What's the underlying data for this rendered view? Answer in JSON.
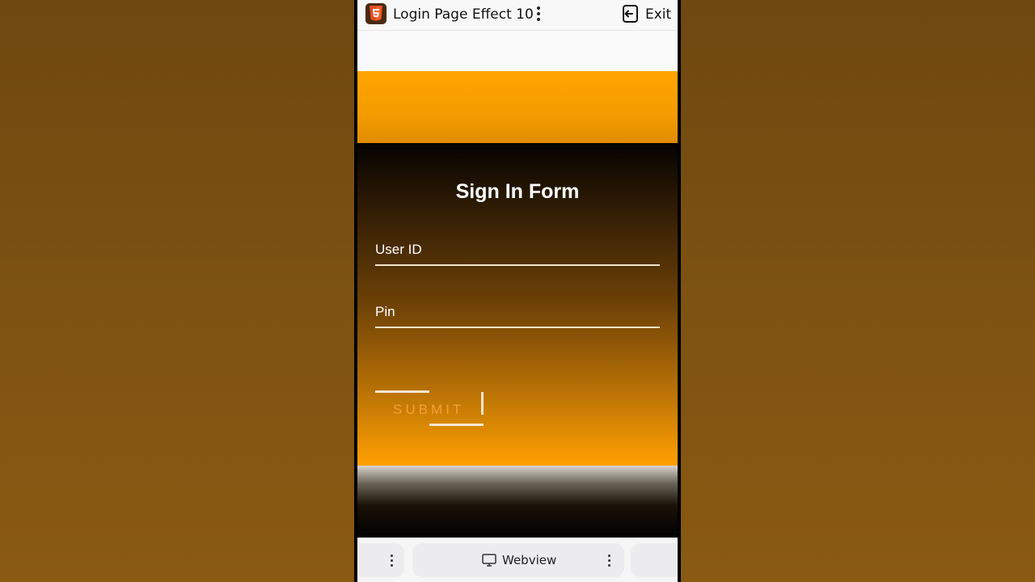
{
  "app": {
    "icon_name": "html5-icon",
    "title": "Login Page Effect 10",
    "exit_label": "Exit"
  },
  "form": {
    "title": "Sign In Form",
    "user_label": "User ID",
    "pin_label": "Pin",
    "submit_label": "SUBMIT"
  },
  "bottom": {
    "webview_label": "Webview"
  },
  "colors": {
    "accent_orange": "#ffa500",
    "background_brown": "#7d5212",
    "submit_text": "#f0a13a"
  }
}
